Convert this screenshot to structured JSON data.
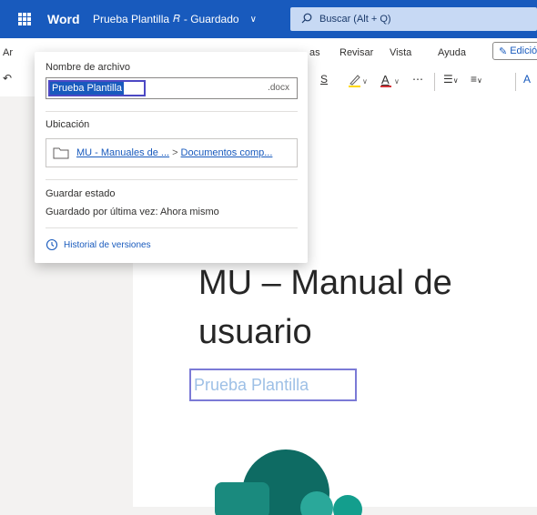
{
  "appbar": {
    "brand": "Word",
    "doc_title": "Prueba Plantilla",
    "status": "- Guardado",
    "search_placeholder": "Buscar (Alt + Q)",
    "colors": {
      "bar": "#185abd",
      "search_bg": "#c7d9f4"
    },
    "icons": [
      "app-launcher-icon",
      "person-icon",
      "chevron-down-icon",
      "search-icon"
    ]
  },
  "ribbon": {
    "tabs": [
      "Ar",
      "as",
      "Revisar",
      "Vista",
      "Ayuda"
    ],
    "edit_button": "Edició",
    "icons": [
      "undo-icon",
      "underline-icon",
      "highlight-icon",
      "font-color-icon",
      "more-icon",
      "bullets-icon",
      "align-icon",
      "styles-icon"
    ]
  },
  "popup": {
    "filename_label": "Nombre de archivo",
    "filename_value": "Prueba Plantilla",
    "extension": ".docx",
    "location_label": "Ubicación",
    "location_part1": "MU - Manuales de ...",
    "location_separator": ">",
    "location_part2": "Documentos comp...",
    "save_state_label": "Guardar estado",
    "save_state_value": "Guardado por última vez: Ahora mismo",
    "version_history": "Historial de versiones"
  },
  "document": {
    "title_line1": "MU – Manual de",
    "title_line2": "usuario",
    "subtitle": "Prueba Plantilla"
  }
}
